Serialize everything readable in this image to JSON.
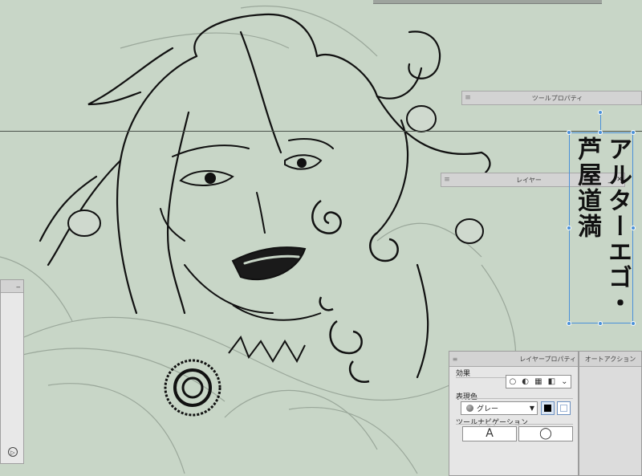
{
  "canvas": {
    "background": "#c8d6c7",
    "line_color": "#111111"
  },
  "palettes": {
    "tool_property": {
      "title": "ツールプロパティ"
    },
    "layer": {
      "title": "レイヤー"
    }
  },
  "text_object": {
    "lines": [
      "アルターエゴ・",
      "芦屋道満"
    ],
    "selection_color": "#4a90d9"
  },
  "left_panel": {
    "minimize": "_",
    "play_icon": "▷"
  },
  "layer_property": {
    "title": "レイヤープロパティ",
    "effect_label": "効果",
    "expression_color_label": "表現色",
    "expression_color_value": "グレー",
    "tool_navigation_label": "ツールナビゲーション",
    "text_tool_button": "A"
  },
  "auto_action": {
    "title": "オートアクション"
  }
}
